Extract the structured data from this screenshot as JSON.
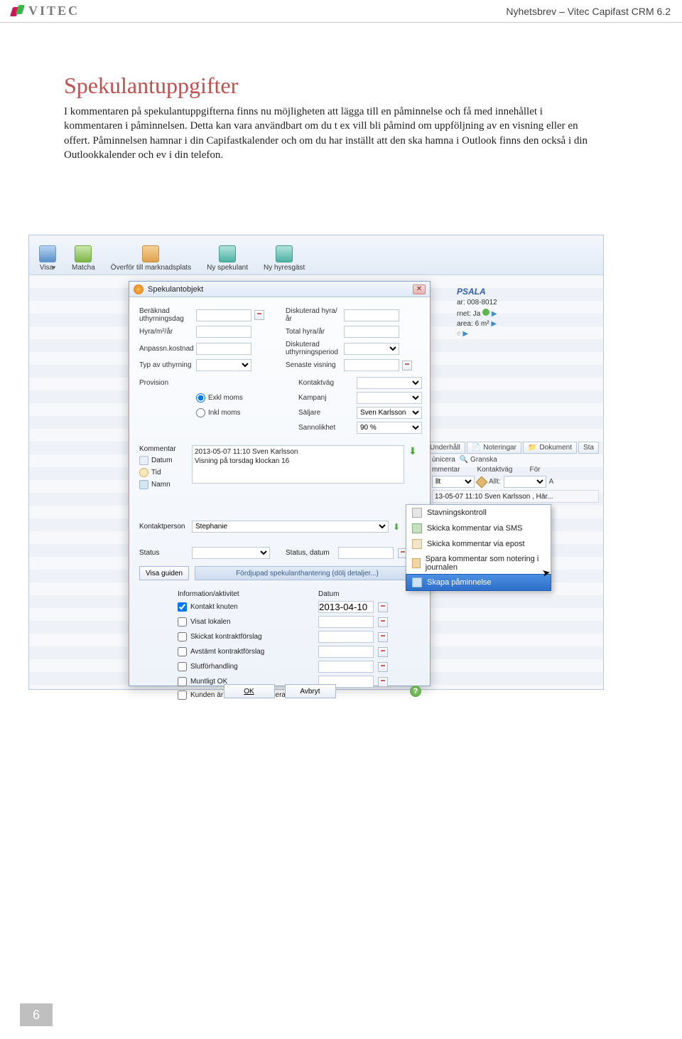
{
  "header": {
    "brand": "VITEC",
    "right": "Nyhetsbrev – Vitec Capifast CRM 6.2"
  },
  "doc": {
    "title": "Spekulantuppgifter",
    "paragraph": "I kommentaren på spekulantuppgifterna finns nu möjligheten att lägga till en påminnelse och få med innehållet i kommentaren i påminnelsen. Detta kan vara användbart om du t ex vill bli påmind om uppföljning av en visning eller en offert. Påminnelsen hamnar i din Capifastkalender och om du har inställt att den ska hamna i Outlook finns den också i din Outlookkalender och ev i din telefon."
  },
  "toolbar": [
    {
      "name": "visa",
      "label": "Visa",
      "iconClass": "blue",
      "hasCaret": true
    },
    {
      "name": "matcha",
      "label": "Matcha",
      "iconClass": "green"
    },
    {
      "name": "overfor",
      "label": "Överför till marknadsplats",
      "iconClass": "orange"
    },
    {
      "name": "ny-spekulant",
      "label": "Ny spekulant",
      "iconClass": "teal"
    },
    {
      "name": "ny-hyresgast",
      "label": "Ny hyresgäst",
      "iconClass": "teal"
    }
  ],
  "rightPanel": {
    "title": "PSALA",
    "line1": "ar: 008-8012",
    "line2": "rnet: Ja",
    "line3": "area: 6 m²"
  },
  "rightTabs": [
    "Underhåll",
    "Noteringar",
    "Dokument",
    "Sta"
  ],
  "rightRow2": {
    "cols": [
      {
        "label": "ùnicera",
        "icon": true
      },
      {
        "label": "Granska",
        "icon": true
      }
    ],
    "headers": [
      "mmentar",
      "Kontaktväg",
      "För"
    ],
    "filters": {
      "first": "llt",
      "allLabel": "Allt:",
      "last": "A"
    },
    "rowText": "13-05-07 11:10 Sven Karlsson , Här..."
  },
  "dialog": {
    "title": "Spekulantobjekt",
    "labels": {
      "beraknad": "Beräknad uthyrningsdag",
      "hyra_m2": "Hyra/m²/år",
      "anpassn": "Anpassn.kostnad",
      "typ": "Typ av uthyrning",
      "disk_hyra": "Diskuterad hyra/år",
      "total_hyra": "Total hyra/år",
      "disk_period": "Diskuterad uthyrningsperiod",
      "senaste": "Senaste visning",
      "provision": "Provision",
      "exkl": "Exkl moms",
      "inkl": "Inkl moms",
      "kontaktvag": "Kontaktväg",
      "kampanj": "Kampanj",
      "saljare": "Säljare",
      "sannolikhet": "Sannolikhet",
      "kommentar": "Kommentar",
      "datum_link": "Datum",
      "tid_link": "Tid",
      "namn_link": "Namn",
      "kontaktperson": "Kontaktperson",
      "status": "Status",
      "status_datum": "Status, datum",
      "visa_guiden": "Visa guiden",
      "expand": "Fördjupad spekulanthantering (dölj detaljer...)",
      "info_akt": "Information/aktivitet",
      "datum_col": "Datum"
    },
    "values": {
      "saljare": "Sven Karlsson",
      "sannolikhet": "90 %",
      "comment_line1": "2013-05-07 11:10 Sven Karlsson",
      "comment_line2": "Visning på torsdag klockan 16",
      "kontaktperson": "Stephanie",
      "datum1": "2013-04-10"
    },
    "activities": [
      {
        "label": "Kontakt knuten",
        "checked": true
      },
      {
        "label": "Visat lokalen",
        "checked": false
      },
      {
        "label": "Skickat kontraktförslag",
        "checked": false
      },
      {
        "label": "Avstämt kontraktförslag",
        "checked": false
      },
      {
        "label": "Slutförhandling",
        "checked": false
      },
      {
        "label": "Muntligt OK",
        "checked": false
      },
      {
        "label": "Kunden är ej längre intresserad",
        "checked": false
      }
    ],
    "buttons": {
      "ok": "OK",
      "cancel": "Avbryt"
    }
  },
  "context_menu": [
    {
      "label": "Stavningskontroll",
      "iconClass": "spell"
    },
    {
      "label": "Skicka kommentar via SMS",
      "iconClass": "sms"
    },
    {
      "label": "Skicka kommentar via epost",
      "iconClass": "mail"
    },
    {
      "label": "Spara kommentar som notering i journalen",
      "iconClass": "save"
    },
    {
      "label": "Skapa påminnelse",
      "iconClass": "remind",
      "selected": true
    }
  ],
  "page_number": "6"
}
